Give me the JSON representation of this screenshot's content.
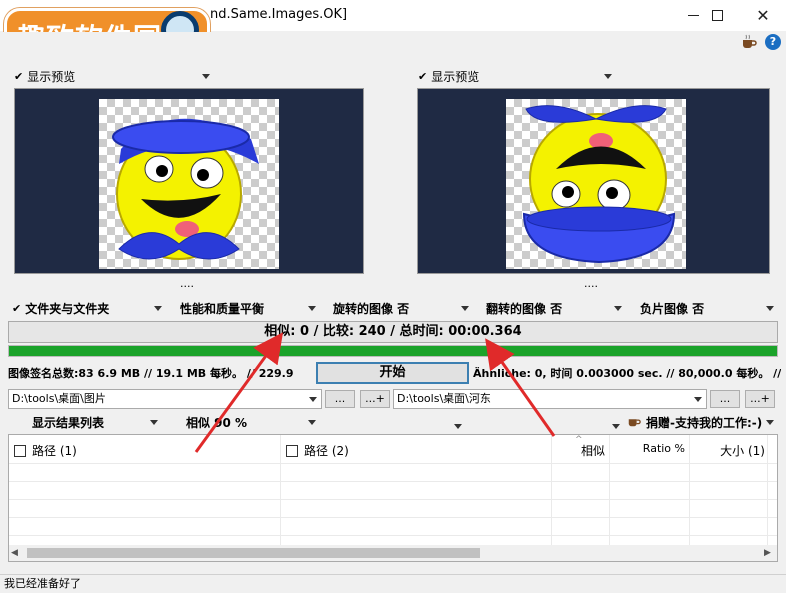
{
  "window": {
    "title": "nd.Same.Images.OK]",
    "minimize": "—",
    "maximize": "☐",
    "close": "✕"
  },
  "watermark": {
    "text": "趣致软件园"
  },
  "toolbar": {
    "coffee_icon": "coffee-icon",
    "help": "?"
  },
  "preview_left": {
    "label": "显示预览",
    "dots": "...."
  },
  "preview_right": {
    "label": "显示预览",
    "dots": "...."
  },
  "options": {
    "folder_mode": "文件夹与文件夹",
    "perf_quality": "性能和质量平衡",
    "rotated": "旋转的图像 否",
    "flipped": "翻转的图像 否",
    "negative": "负片图像 否"
  },
  "status": {
    "text": "相似: 0 / 比较: 240 / 总时间: 00:00.364"
  },
  "progress": {
    "fraction": 1.0,
    "color": "#1ba32a"
  },
  "stats": {
    "left": "图像签名总数:83   6.9 MB // 19.1 MB 每秒。 // 229.9",
    "start_button": "开始",
    "right": "Ähnliche: 0, 时间 0.003000 sec. // 80,000.0 每秒。 //"
  },
  "paths": {
    "left_value": "D:\\tools\\桌面\\图片",
    "right_value": "D:\\tools\\桌面\\河东",
    "browse": "...",
    "add": "...+"
  },
  "results_bar": {
    "show_list": "显示结果列表",
    "similarity": "相似 90 %",
    "donate": "捐赠-支持我的工作:-)"
  },
  "table": {
    "columns": [
      "路径 (1)",
      "路径 (2)",
      "相似",
      "Ratio %",
      "大小 (1)"
    ]
  },
  "statusbar": {
    "text": "我已经准备好了"
  }
}
